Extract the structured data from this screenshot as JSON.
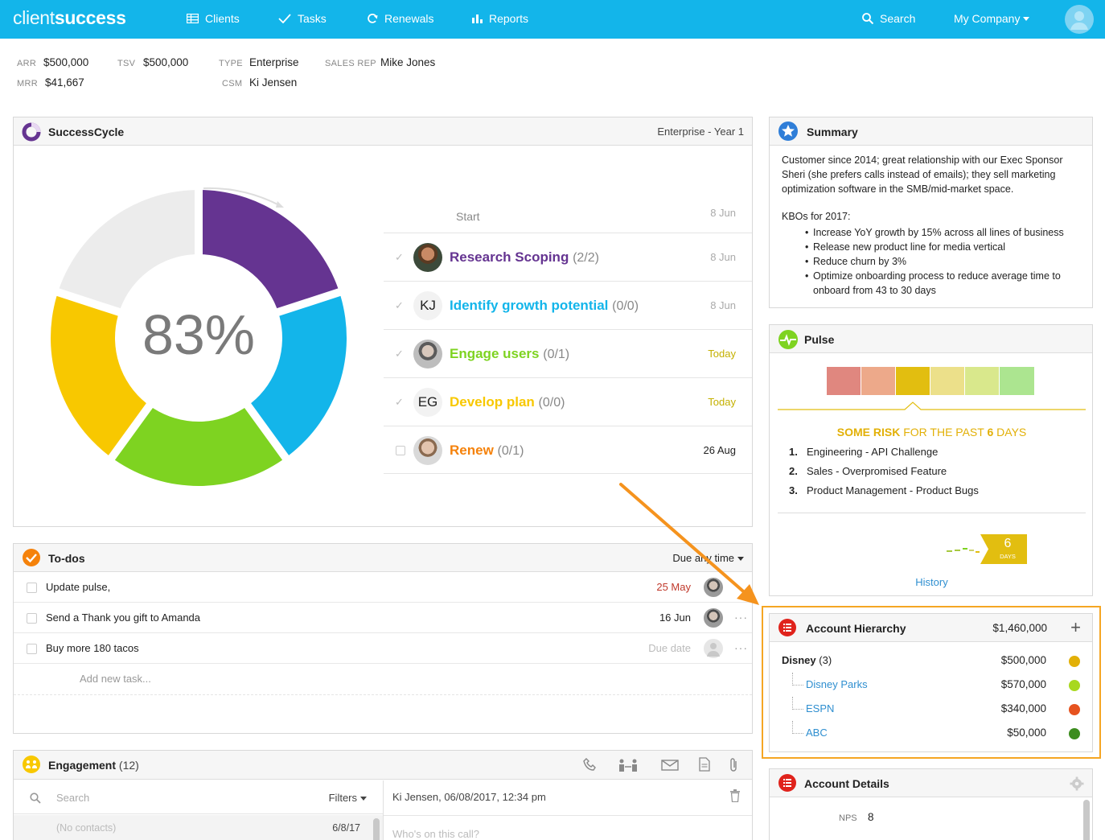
{
  "nav": {
    "logo_light": "client",
    "logo_bold": "success",
    "items": [
      {
        "label": "Clients",
        "icon": "table-icon"
      },
      {
        "label": "Tasks",
        "icon": "check-icon"
      },
      {
        "label": "Renewals",
        "icon": "refresh-icon"
      },
      {
        "label": "Reports",
        "icon": "bar-chart-icon"
      }
    ],
    "search_label": "Search",
    "company_label": "My Company"
  },
  "account_meta": {
    "arr_label": "ARR",
    "arr_value": "$500,000",
    "mrr_label": "MRR",
    "mrr_value": "$41,667",
    "tsv_label": "TSV",
    "tsv_value": "$500,000",
    "type_label": "TYPE",
    "type_value": "Enterprise",
    "csm_label": "CSM",
    "csm_value": "Ki Jensen",
    "sales_rep_label": "SALES REP",
    "sales_rep_value": "Mike Jones"
  },
  "successcycle": {
    "title": "SuccessCycle",
    "stage": "Enterprise - Year 1",
    "percent": "83%",
    "start_label": "Start",
    "start_date": "8 Jun",
    "steps": [
      {
        "name": "Research Scoping",
        "count": "(2/2)",
        "date": "8 Jun",
        "color": "#653491",
        "initials": "",
        "done": true
      },
      {
        "name": "Identify growth potential",
        "count": "(0/0)",
        "date": "8 Jun",
        "color": "#13b5ea",
        "initials": "KJ",
        "done": true
      },
      {
        "name": "Engage users",
        "count": "(0/1)",
        "date": "Today",
        "color": "#7ed321",
        "initials": "",
        "done": true
      },
      {
        "name": "Develop plan",
        "count": "(0/0)",
        "date": "Today",
        "color": "#f8c800",
        "initials": "EG",
        "done": true
      },
      {
        "name": "Renew",
        "count": "(0/1)",
        "date": "26 Aug",
        "color": "#f5820b",
        "initials": "",
        "done": false
      }
    ]
  },
  "summary": {
    "title": "Summary",
    "paragraph": "Customer since 2014; great relationship with our Exec Sponsor Sheri (she prefers calls instead of emails); they sell marketing optimization software in the SMB/mid-market space.",
    "kbo_heading": "KBOs for 2017:",
    "kbos": [
      "Increase YoY growth by 15% across all lines of business",
      "Release new product line for media vertical",
      "Reduce churn by 3%",
      "Optimize onboarding process to reduce average time to onboard from 43 to 30 days"
    ]
  },
  "pulse": {
    "title": "Pulse",
    "scale_colors": [
      "#e0877f",
      "#eda98a",
      "#e2be10",
      "#ece08a",
      "#d9e88c",
      "#ace590"
    ],
    "selected_index": 2,
    "risk_prefix": "SOME RISK",
    "risk_middle": " FOR THE PAST ",
    "risk_days": "6",
    "risk_suffix": " DAYS",
    "reasons": [
      {
        "num": "1.",
        "text": "Engineering - API Challenge"
      },
      {
        "num": "2.",
        "text": "Sales - Overpromised Feature"
      },
      {
        "num": "3.",
        "text": "Product Management - Product Bugs"
      }
    ],
    "days_count": "6",
    "days_label": "DAYS",
    "history_label": "History"
  },
  "hierarchy": {
    "title": "Account Hierarchy",
    "total": "$1,460,000",
    "parent": {
      "name": "Disney",
      "count": "(3)",
      "value": "$500,000",
      "color": "#e2b007"
    },
    "children": [
      {
        "name": "Disney Parks",
        "value": "$570,000",
        "color": "#a8d81f"
      },
      {
        "name": "ESPN",
        "value": "$340,000",
        "color": "#e6531f"
      },
      {
        "name": "ABC",
        "value": "$50,000",
        "color": "#3c8c1e"
      }
    ]
  },
  "account_details": {
    "title": "Account Details",
    "nps_label": "NPS",
    "nps_value": "8"
  },
  "todos": {
    "title": "To-dos",
    "filter_label": "Due any time",
    "items": [
      {
        "text": "Update pulse,",
        "date": "25 May",
        "date_color": "#c0392b"
      },
      {
        "text": "Send a Thank you gift to Amanda",
        "date": "16 Jun",
        "date_color": "#222"
      },
      {
        "text": "Buy more 180 tacos",
        "date": "Due date",
        "date_color": "#bbb"
      }
    ],
    "add_placeholder": "Add new task..."
  },
  "engagement": {
    "title": "Engagement",
    "count": "(12)",
    "search_placeholder": "Search",
    "filters_label": "Filters",
    "entry_header": "Ki Jensen, 06/08/2017, 12:34 pm",
    "list_row_contacts": "(No contacts)",
    "list_row_date": "6/8/17",
    "call_placeholder": "Who's on this call?"
  },
  "chart_data": {
    "type": "pie",
    "title": "",
    "center_label": "83%",
    "categories": [
      "Research Scoping",
      "Identify growth potential",
      "Engage users",
      "Develop plan",
      "Renew"
    ],
    "values": [
      1,
      1,
      1,
      1,
      1
    ],
    "colors": [
      "#653491",
      "#13b5ea",
      "#7ed321",
      "#f8c800",
      "#ececec"
    ]
  }
}
